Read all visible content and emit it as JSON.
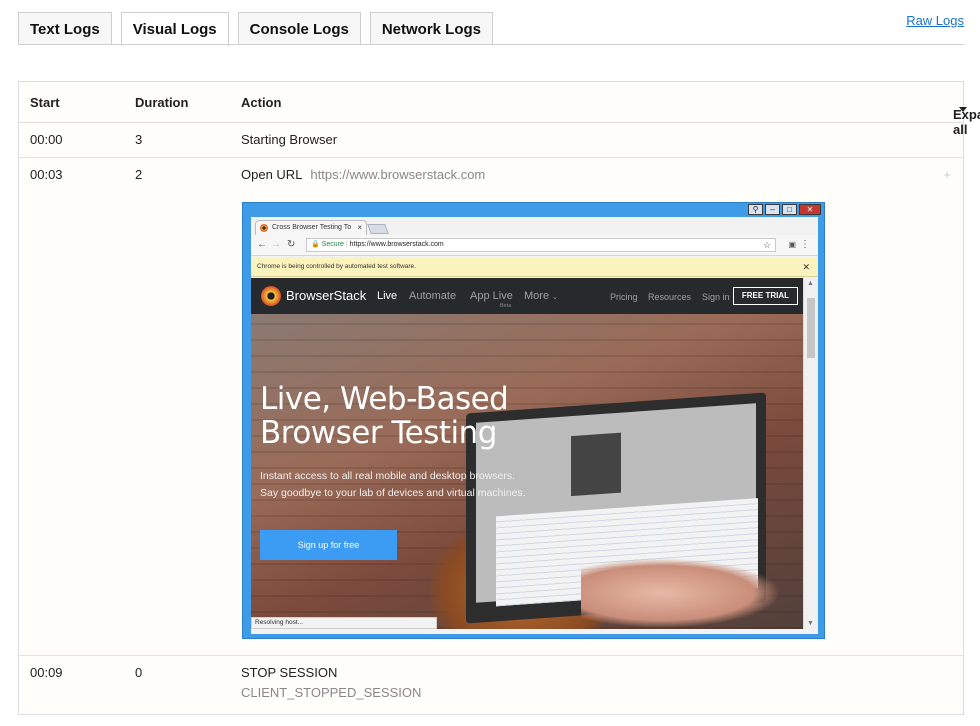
{
  "tabs": [
    {
      "label": "Text Logs",
      "active": false
    },
    {
      "label": "Visual Logs",
      "active": true
    },
    {
      "label": "Console Logs",
      "active": false
    },
    {
      "label": "Network Logs",
      "active": false
    }
  ],
  "raw_logs": "Raw Logs",
  "table": {
    "headers": {
      "start": "Start",
      "duration": "Duration",
      "action": "Action",
      "expand_all": "Expand all"
    },
    "rows": [
      {
        "start": "00:00",
        "duration": "3",
        "action": "Starting Browser"
      },
      {
        "start": "00:03",
        "duration": "2",
        "action": "Open URL",
        "detail": "https://www.browserstack.com",
        "toggle": "+"
      },
      {
        "start": "00:09",
        "duration": "0",
        "action": "STOP SESSION",
        "detail": "CLIENT_STOPPED_SESSION"
      }
    ]
  },
  "screenshot": {
    "browser_tab_title": "Cross Browser Testing To",
    "secure_label": "Secure",
    "url": "https://www.browserstack.com",
    "infobar": "Chrome is being controlled by automated test software.",
    "site": {
      "brand": "BrowserStack",
      "nav": [
        "Live",
        "Automate",
        "App Live",
        "More"
      ],
      "beta": "Beta",
      "right_nav": [
        "Pricing",
        "Resources",
        "Sign in"
      ],
      "free_trial": "FREE TRIAL",
      "headline_1": "Live, Web-Based",
      "headline_2": "Browser Testing",
      "sub_1": "Instant access to all real mobile and desktop browsers.",
      "sub_2": "Say goodbye to your lab of devices and virtual machines.",
      "cta": "Sign up for free"
    },
    "status": "Resolving host...",
    "colors": {
      "window_frame": "#3d9be7",
      "cta": "#3c9bf2",
      "infobar": "#fbf3bd"
    }
  }
}
